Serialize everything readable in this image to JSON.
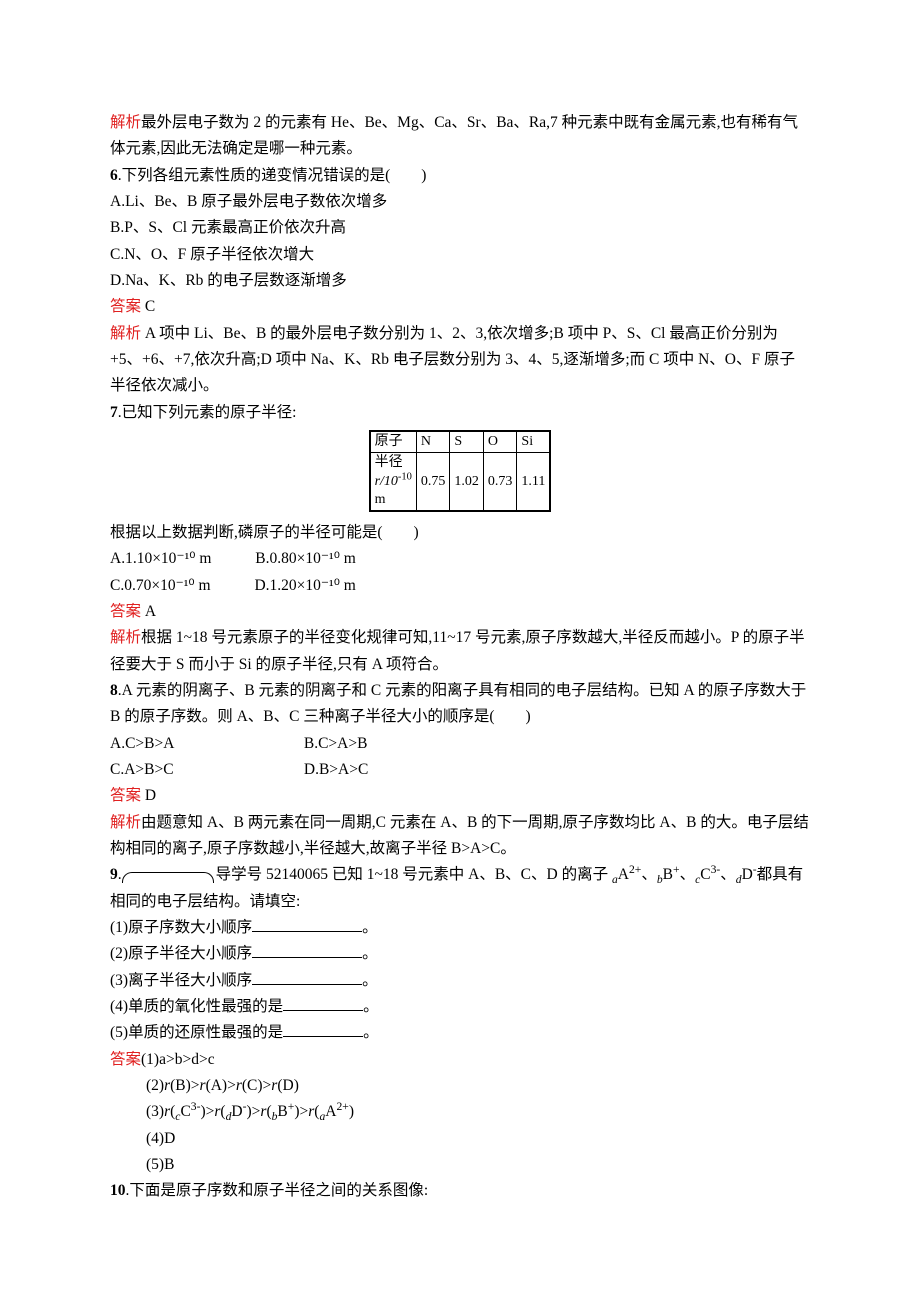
{
  "intro": {
    "explain_label": "解析",
    "answer_label": "答案",
    "explain5": "最外层电子数为 2 的元素有 He、Be、Mg、Ca、Sr、Ba、Ra,7 种元素中既有金属元素,也有稀有气体元素,因此无法确定是哪一种元素。"
  },
  "q6": {
    "num": "6",
    "stem": ".下列各组元素性质的递变情况错误的是(　　)",
    "A": "A.Li、Be、B 原子最外层电子数依次增多",
    "B": "B.P、S、Cl 元素最高正价依次升高",
    "C": "C.N、O、F 原子半径依次增大",
    "D": "D.Na、K、Rb 的电子层数逐渐增多",
    "answer": " C",
    "explain": " A 项中 Li、Be、B 的最外层电子数分别为 1、2、3,依次增多;B 项中 P、S、Cl 最高正价分别为+5、+6、+7,依次升高;D 项中 Na、K、Rb 电子层数分别为 3、4、5,逐渐增多;而 C 项中 N、O、F 原子半径依次减小。"
  },
  "q7": {
    "num": "7",
    "stem": ".已知下列元素的原子半径:",
    "table": {
      "row1": [
        "原子",
        "N",
        "S",
        "O",
        "Si"
      ],
      "row2_label_a": "半径",
      "row2_label_b": "r/10",
      "row2_label_c": "m",
      "values": [
        "0.75",
        "1.02",
        "0.73",
        "1.11"
      ]
    },
    "stem2": "根据以上数据判断,磷原子的半径可能是(　　)",
    "A": "A.1.10×10⁻¹⁰ m",
    "B": "B.0.80×10⁻¹⁰ m",
    "C": "C.0.70×10⁻¹⁰ m",
    "D": "D.1.20×10⁻¹⁰ m",
    "answer": " A",
    "explain": "根据 1~18 号元素原子的半径变化规律可知,11~17 号元素,原子序数越大,半径反而越小。P 的原子半径要大于 S 而小于 Si 的原子半径,只有 A 项符合。"
  },
  "q8": {
    "num": "8",
    "stem": ".A 元素的阴离子、B 元素的阴离子和 C 元素的阳离子具有相同的电子层结构。已知 A 的原子序数大于 B 的原子序数。则 A、B、C 三种离子半径大小的顺序是(　　)",
    "A": "A.C>B>A",
    "B": "B.C>A>B",
    "C": "C.A>B>C",
    "D": "D.B>A>C",
    "answer": " D",
    "explain": "由题意知 A、B 两元素在同一周期,C 元素在 A、B 的下一周期,原子序数均比 A、B 的大。电子层结构相同的离子,原子序数越小,半径越大,故离子半径 B>A>C。"
  },
  "q9": {
    "num": "9",
    "lead": "导学号 52140065 已知 1~18 号元素中 A、B、C、D 的离子 ",
    "lead_tail": "都具有相同的电子层结构。请填空:",
    "p1": "(1)原子序数大小顺序",
    "p2": "(2)原子半径大小顺序",
    "p3": "(3)离子半径大小顺序",
    "p4": "(4)单质的氧化性最强的是",
    "p5": "(5)单质的还原性最强的是",
    "period": "。",
    "ans1": "(1)a>b>d>c",
    "ans4": "(4)D",
    "ans5": "(5)B",
    "r": "r"
  },
  "q10": {
    "num": "10",
    "stem": ".下面是原子序数和原子半径之间的关系图像:"
  },
  "chart_data": {
    "type": "table",
    "title": "原子半径",
    "columns": [
      "原子",
      "半径 r/10⁻¹⁰ m"
    ],
    "rows": [
      {
        "atom": "N",
        "radius": 0.75
      },
      {
        "atom": "S",
        "radius": 1.02
      },
      {
        "atom": "O",
        "radius": 0.73
      },
      {
        "atom": "Si",
        "radius": 1.11
      }
    ]
  }
}
